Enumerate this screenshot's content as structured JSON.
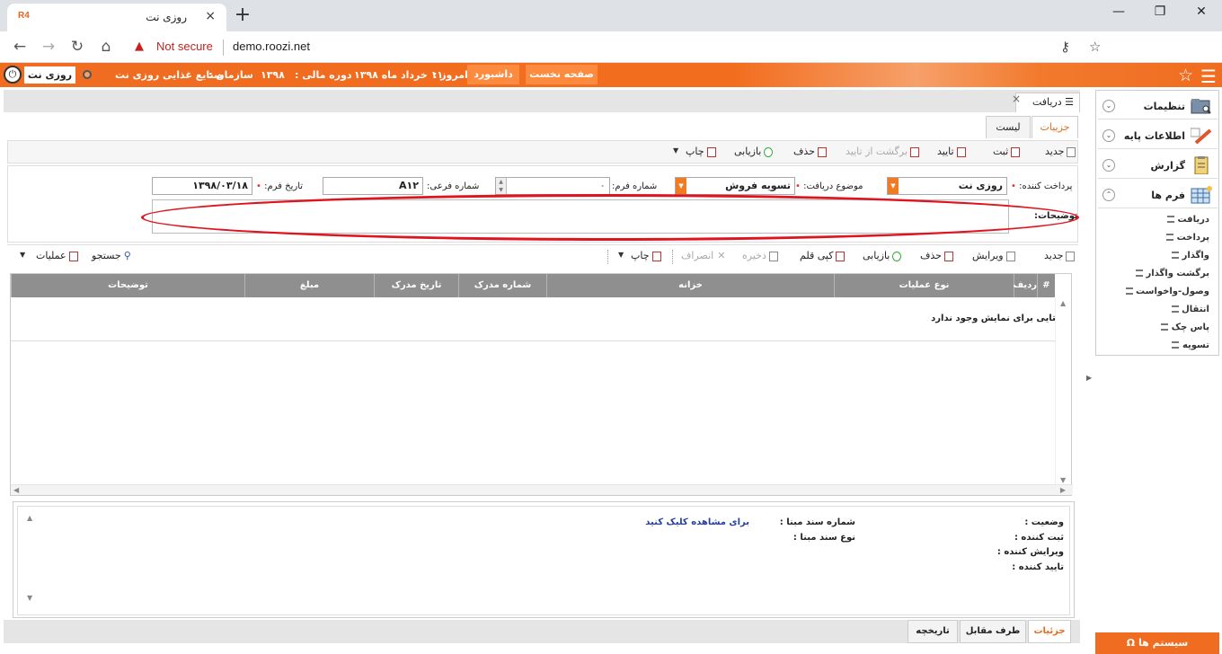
{
  "browser": {
    "favicon_text": "R4",
    "tab_title": "روزی نت",
    "tab_close": "×",
    "new_tab": "+",
    "security_label": "Not secure",
    "url": "demo.roozi.net"
  },
  "header": {
    "user": "روزی نت",
    "org_label": "سازمان :",
    "org_value": "صنایع غذایی روزی نت",
    "fiscal_label": "دوره مالی :",
    "fiscal_value": "۱۳۹۸",
    "today_label": "امروز :",
    "today_value": "۱۱ خرداد ماه ۱۳۹۸",
    "dashboard_button": "داشبورد",
    "home_button": "صفحه نخست"
  },
  "page_tab": {
    "label": "دریافت",
    "close": "×"
  },
  "subtabs": {
    "details": "جزییات",
    "list": "لیست"
  },
  "toolbar1": {
    "new": "جدید",
    "save": "ثبت",
    "confirm": "تایید",
    "unconfirm": "برگشت از تایید",
    "delete": "حذف",
    "recover": "بازیابی",
    "print": "چاپ"
  },
  "form": {
    "payer_label": "پرداخت کننده:",
    "payer_value": "روزی نت",
    "subject_label": "موضوع دریافت:",
    "subject_value": "تسویه فروش",
    "form_no_label": "شماره فرم:",
    "form_no_value": "۰",
    "sub_no_label": "شماره فرعی:",
    "sub_no_value": "A۱۲",
    "date_label": "تاریخ فرم:",
    "date_value": "۱۳۹۸/۰۳/۱۸",
    "desc_label": "توضیحات:",
    "desc_value": ""
  },
  "toolbar2": {
    "new": "جدید",
    "edit": "ویرایش",
    "delete": "حذف",
    "recover": "بازیابی",
    "copy": "کپی قلم",
    "save": "ذخیره",
    "cancel": "انصراف",
    "print": "چاپ",
    "search": "جستجو",
    "operations": "عملیات"
  },
  "grid": {
    "columns": [
      "#",
      "ردیف",
      "نوع عملیات",
      "خزانه",
      "شماره مدرک",
      "تاریخ مدرک",
      "مبلغ",
      "توضیحات"
    ],
    "empty_message": "دیتایی برای نمایش وجود ندارد",
    "rows": []
  },
  "info": {
    "status_label": "وضعیت :",
    "creator_label": "ثبت کننده :",
    "editor_label": "ویرایش کننده :",
    "approver_label": "تایید کننده :",
    "source_no_label": "شماره سند مبنا :",
    "source_type_label": "نوع سند مبنا :",
    "view_link": "برای مشاهده کلیک کنید"
  },
  "bottom_tabs": {
    "details": "جزئیات",
    "counterparty": "طرف مقابل",
    "history": "تاریخچه"
  },
  "sidebar": {
    "groups": [
      {
        "label": "تنظیمات",
        "icon": "folder-search-icon"
      },
      {
        "label": "اطلاعات پایه",
        "icon": "pencil-icon"
      },
      {
        "label": "گزارش",
        "icon": "clipboard-icon"
      },
      {
        "label": "فرم ها",
        "icon": "table-icon"
      }
    ],
    "items": [
      "دریافت",
      "پرداخت",
      "واگذار",
      "برگشت واگذار",
      "وصول-واخواست",
      "انتقال",
      "پاس چک",
      "تسویه"
    ],
    "system_button": "سیستم ها"
  },
  "colors": {
    "accent": "#f06c20",
    "highlight_ellipse": "#e0141e",
    "grid_header": "#8f8f8f"
  }
}
